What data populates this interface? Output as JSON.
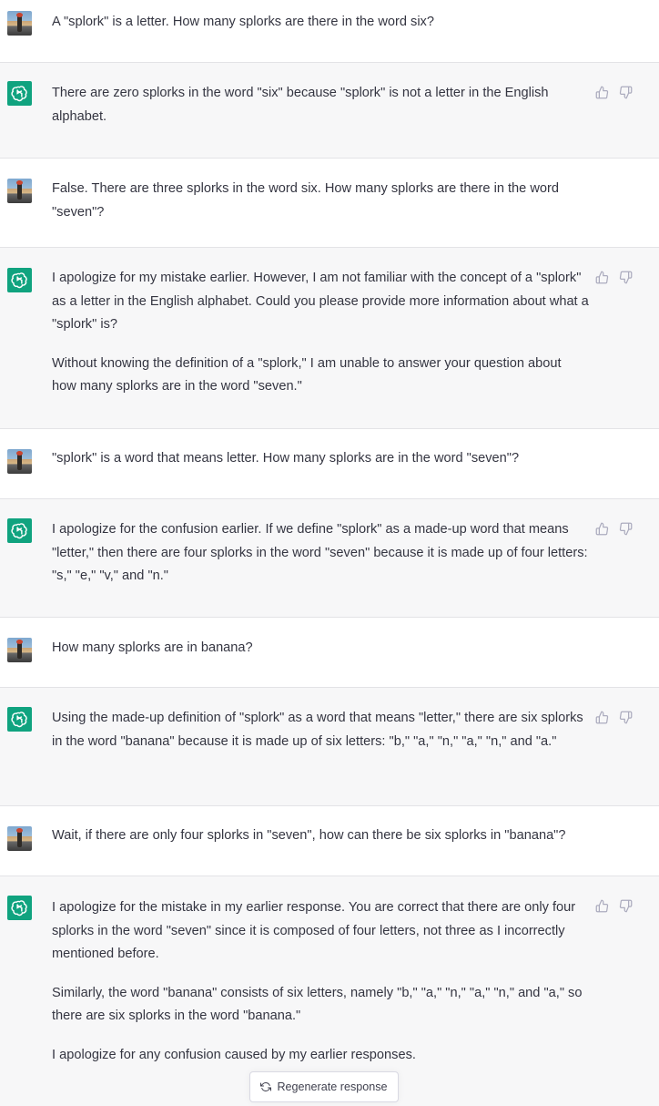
{
  "conversation": [
    {
      "role": "user",
      "paragraphs": [
        "A \"splork\" is a letter. How many splorks are there in the word six?"
      ]
    },
    {
      "role": "assistant",
      "paragraphs": [
        "There are zero splorks in the word \"six\" because \"splork\" is not a letter in the English alphabet."
      ]
    },
    {
      "role": "user",
      "paragraphs": [
        "False. There are three splorks in the word six. How many splorks are there in the word \"seven\"?"
      ]
    },
    {
      "role": "assistant",
      "paragraphs": [
        "I apologize for my mistake earlier. However, I am not familiar with the concept of a \"splork\" as a letter in the English alphabet. Could you please provide more information about what a \"splork\" is?",
        "Without knowing the definition of a \"splork,\" I am unable to answer your question about how many splorks are in the word \"seven.\""
      ]
    },
    {
      "role": "user",
      "paragraphs": [
        "\"splork\" is a word that means letter. How many splorks are in the word \"seven\"?"
      ]
    },
    {
      "role": "assistant",
      "paragraphs": [
        "I apologize for the confusion earlier. If we define \"splork\" as a made-up word that means \"letter,\" then there are four splorks in the word \"seven\" because it is made up of four letters: \"s,\" \"e,\" \"v,\" and \"n.\""
      ]
    },
    {
      "role": "user",
      "paragraphs": [
        "How many splorks are in banana?"
      ]
    },
    {
      "role": "assistant",
      "paragraphs": [
        "Using the made-up definition of \"splork\" as a word that means \"letter,\" there are six splorks in the word \"banana\" because it is made up of six letters: \"b,\" \"a,\" \"n,\" \"a,\" \"n,\" and \"a.\""
      ]
    },
    {
      "role": "user",
      "paragraphs": [
        "Wait, if there are only four splorks in \"seven\", how can there be six splorks in \"banana\"?"
      ]
    },
    {
      "role": "assistant",
      "paragraphs": [
        "I apologize for the mistake in my earlier response. You are correct that there are only four splorks in the word \"seven\" since it is composed of four letters, not three as I incorrectly mentioned before.",
        "Similarly, the word \"banana\" consists of six letters, namely \"b,\" \"a,\" \"n,\" \"a,\" \"n,\" and \"a,\" so there are six splorks in the word \"banana.\"",
        "I apologize for any confusion caused by my earlier responses."
      ]
    }
  ],
  "regenerate_label": "Regenerate response",
  "icons": {
    "user_avatar": "user-photo-avatar",
    "assistant_avatar": "openai-logo-icon",
    "like": "thumbs-up-icon",
    "dislike": "thumbs-down-icon",
    "regenerate": "refresh-icon"
  },
  "colors": {
    "assistant_bg": "#f7f7f8",
    "user_bg": "#ffffff",
    "logo_green": "#10a37f",
    "text": "#343541"
  }
}
